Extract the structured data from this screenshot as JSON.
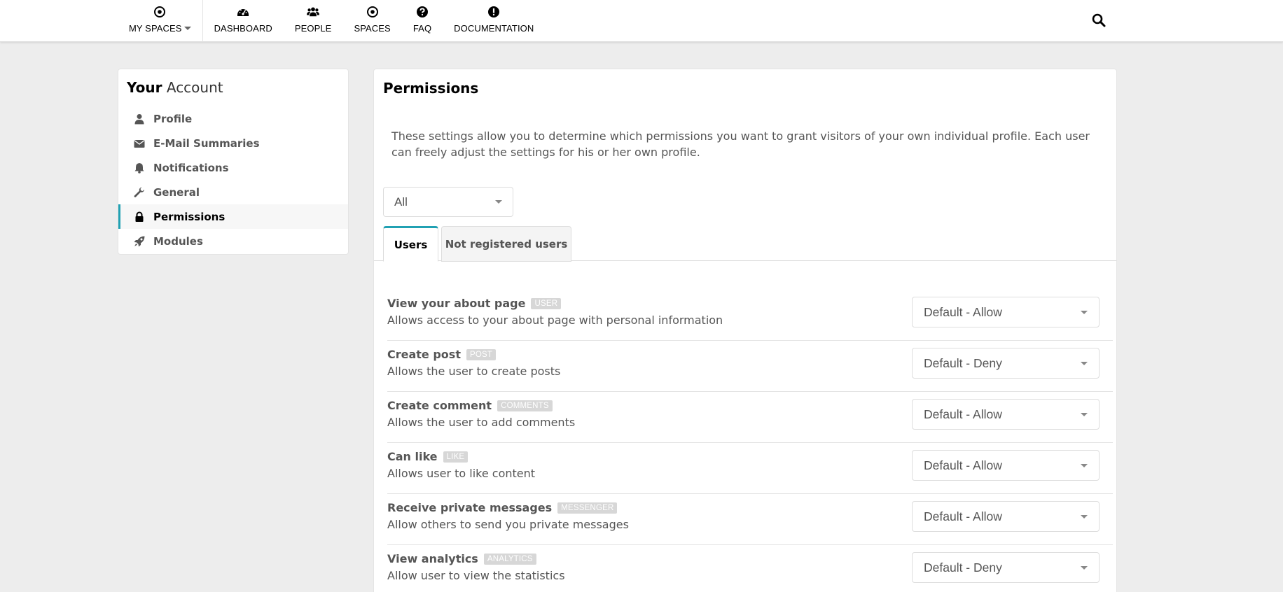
{
  "nav": {
    "items": [
      {
        "label": "MY SPACES",
        "icon": "dot-circle-icon"
      },
      {
        "label": "DASHBOARD",
        "icon": "tachometer-icon"
      },
      {
        "label": "PEOPLE",
        "icon": "users-icon"
      },
      {
        "label": "SPACES",
        "icon": "dot-circle-icon"
      },
      {
        "label": "FAQ",
        "icon": "question-circle-icon"
      },
      {
        "label": "DOCUMENTATION",
        "icon": "exclamation-circle-icon"
      }
    ],
    "search_icon": "search-icon"
  },
  "account": {
    "title_bold": "Your",
    "title_light": "Account",
    "menu": [
      {
        "label": "Profile",
        "icon": "user-icon"
      },
      {
        "label": "E-Mail Summaries",
        "icon": "envelope-icon"
      },
      {
        "label": "Notifications",
        "icon": "bell-icon"
      },
      {
        "label": "General",
        "icon": "wrench-icon"
      },
      {
        "label": "Permissions",
        "icon": "lock-icon",
        "active": true
      },
      {
        "label": "Modules",
        "icon": "rocket-icon"
      }
    ]
  },
  "permissions": {
    "title": "Permissions",
    "description": "These settings allow you to determine which permissions you want to grant visitors of your own individual profile. Each user can freely adjust the settings for his or her own profile.",
    "filter_value": "All",
    "tabs": [
      {
        "label": "Users",
        "active": true
      },
      {
        "label": "Not registered users",
        "active": false
      }
    ],
    "rows": [
      {
        "title": "View your about page",
        "badge": "USER",
        "description": "Allows access to your about page with personal information",
        "value": "Default - Allow"
      },
      {
        "title": "Create post",
        "badge": "POST",
        "description": "Allows the user to create posts",
        "value": "Default - Deny"
      },
      {
        "title": "Create comment",
        "badge": "COMMENTS",
        "description": "Allows the user to add comments",
        "value": "Default - Allow"
      },
      {
        "title": "Can like",
        "badge": "LIKE",
        "description": "Allows user to like content",
        "value": "Default - Allow"
      },
      {
        "title": "Receive private messages",
        "badge": "MESSENGER",
        "description": "Allow others to send you private messages",
        "value": "Default - Allow"
      },
      {
        "title": "View analytics",
        "badge": "ANALYTICS",
        "description": "Allow user to view the statistics",
        "value": "Default - Deny"
      }
    ]
  },
  "colors": {
    "accent": "#21a1b3",
    "badge": "#d7d7d7",
    "background": "#ededed"
  }
}
